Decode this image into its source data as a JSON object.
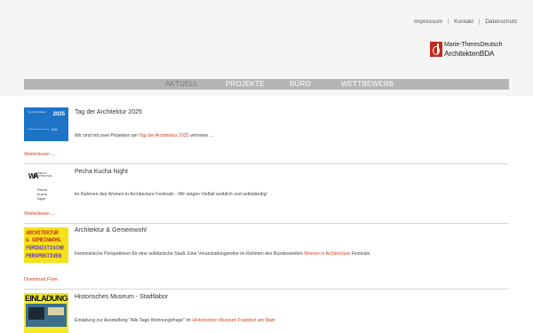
{
  "header": {
    "util_links": [
      "Impressum",
      "Kontakt",
      "Datenschutz"
    ],
    "logo": {
      "line1": "Marie-TheresDeutsch",
      "line2": "ArchitektenBDA"
    }
  },
  "nav": {
    "items": [
      "AKTUELL",
      "PROJEKTE",
      "BÜRO",
      "WETTBEWERB"
    ],
    "active": "AKTUELL"
  },
  "posts": [
    {
      "title": "Tag der Architektur 2025",
      "desc_pre": "Wir sind mit zwei Projekten am ",
      "desc_link": "Tag der Architektur 2025",
      "desc_post": " vertreten ...",
      "more": "Weiterlesen ...",
      "thumb": {
        "a": "Tag der Architektur",
        "b": "2025",
        "c": "Architektenkammer Hessen",
        "d": "A N"
      }
    },
    {
      "title": "Pecha Kucha Night",
      "desc_pre": "im Rahmen des Women in Architecture Festivals - Wir zeigen Vielfalt weiblich und selbständig!",
      "desc_link": "",
      "desc_post": "",
      "more": "Weiterlesen ...",
      "thumb": {
        "ww": "WA",
        "wt1": "WOMEN IN",
        "wt2": "ARCHITECTURE",
        "pk1": "Pecha",
        "pk2": "Kucha",
        "pk3": "Night"
      }
    },
    {
      "title": "Architektur & Gemeinwohl",
      "desc_pre": "Feministische Perspektiven für eine solidarische Stadt. Eine Veranstaltungsreihe im Rahmen des Bundesweiten ",
      "desc_link": "Women in Architecture",
      "desc_post": " Festivals.",
      "more": "Download Flyer",
      "thumb": {
        "l1": "ARCHITEKTUR",
        "l2": "& GEMEINWOHL",
        "l3": "FEMINISTISCHE",
        "l4": "PERSPEKTIVEN"
      }
    },
    {
      "title": "Historisches Museum - Stadtlabor",
      "desc_pre": "Einladung zur Ausstellung \"Alle Tage Wohnungsfrage\" im ",
      "desc_link": "Historischen Museum Frankfurt am Main",
      "desc_post": "",
      "more": "",
      "thumb": {
        "big": "EINLADUNG"
      }
    }
  ],
  "colors": {
    "accent": "#d2411e",
    "nav_bg": "#b5b5b5",
    "header_bg": "#f6f5f5",
    "logo_red": "#c22a1e"
  }
}
